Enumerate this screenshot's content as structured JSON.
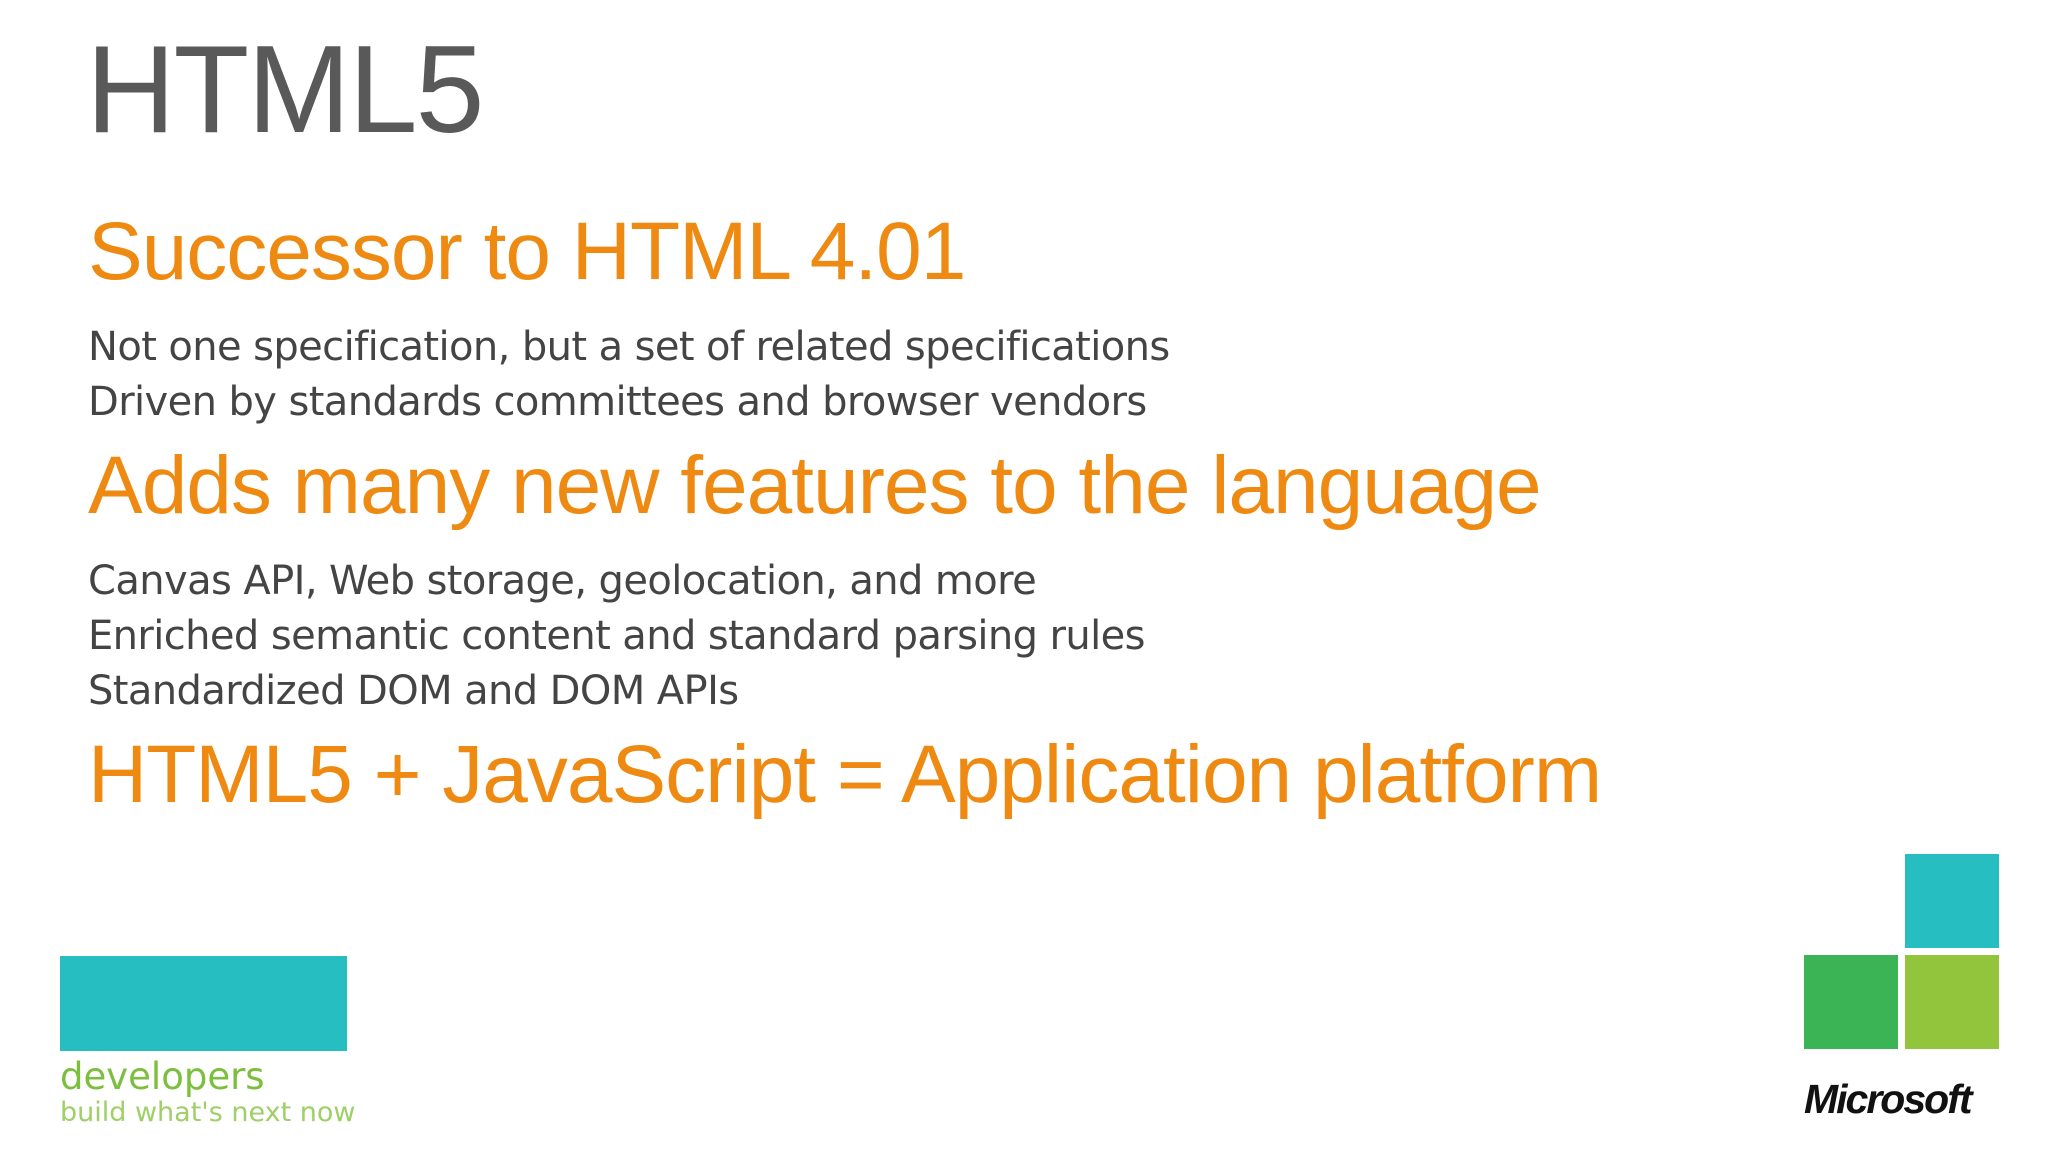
{
  "slide": {
    "title": "HTML5",
    "sections": [
      {
        "heading": "Successor to HTML 4.01",
        "bullets": [
          "Not one specification, but a set of related specifications",
          "Driven by standards committees and browser vendors"
        ]
      },
      {
        "heading": "Adds many new features to the language",
        "bullets": [
          "Canvas API, Web storage, geolocation, and more",
          "Enriched semantic content and standard parsing rules",
          "Standardized DOM and DOM APIs"
        ]
      },
      {
        "heading": "HTML5 + JavaScript = Application platform",
        "bullets": []
      }
    ]
  },
  "footer": {
    "developers_word": "developers",
    "developers_tagline": "build what's next now",
    "microsoft_word": "Microsoft",
    "colors": {
      "cyan": "#27bec2",
      "green": "#3bb456",
      "lime": "#92c43c",
      "orange": "#ee8a12"
    }
  }
}
